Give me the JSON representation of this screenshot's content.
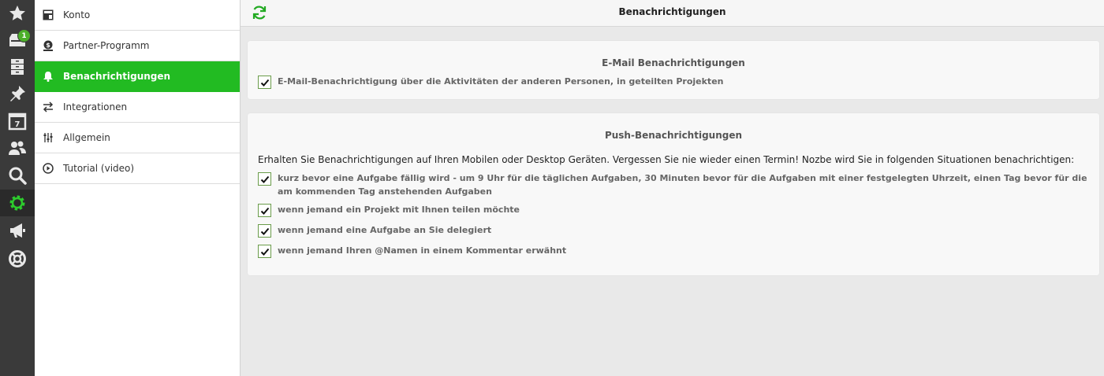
{
  "rail": {
    "items": [
      {
        "name": "favorites-icon"
      },
      {
        "name": "inbox-icon",
        "badge": "1"
      },
      {
        "name": "projects-icon"
      },
      {
        "name": "priority-pin-icon"
      },
      {
        "name": "calendar-icon",
        "day": "7"
      },
      {
        "name": "contacts-icon"
      },
      {
        "name": "search-icon"
      },
      {
        "name": "settings-gear-icon"
      },
      {
        "name": "news-megaphone-icon"
      },
      {
        "name": "help-lifebuoy-icon"
      }
    ]
  },
  "menu": {
    "items": [
      {
        "label": "Konto",
        "icon": "account-icon"
      },
      {
        "label": "Partner-Programm",
        "icon": "partner-icon"
      },
      {
        "label": "Benachrichtigungen",
        "icon": "bell-icon",
        "active": true
      },
      {
        "label": "Integrationen",
        "icon": "swap-arrows-icon"
      },
      {
        "label": "Allgemein",
        "icon": "sliders-icon"
      },
      {
        "label": "Tutorial (video)",
        "icon": "play-icon"
      }
    ]
  },
  "header": {
    "title": "Benachrichtigungen"
  },
  "email": {
    "title": "E-Mail Benachrichtigungen",
    "option": "E-Mail-Benachrichtigung über die Aktivitäten der anderen Personen, in geteilten Projekten",
    "checked": true
  },
  "push": {
    "title": "Push-Benachrichtigungen",
    "intro": "Erhalten Sie Benachrichtigungen auf Ihren Mobilen oder Desktop Geräten. Vergessen Sie nie wieder einen Termin! Nozbe wird Sie in folgenden Situationen benachrichtigen:",
    "options": [
      {
        "text": "kurz bevor eine Aufgabe fällig wird - um 9 Uhr für die täglichen Aufgaben, 30 Minuten bevor für die Aufgaben mit einer festgelegten Uhrzeit, einen Tag bevor für die am kommenden Tag anstehenden Aufgaben",
        "checked": true
      },
      {
        "text": "wenn jemand ein Projekt mit Ihnen teilen möchte",
        "checked": true
      },
      {
        "text": "wenn jemand eine Aufgabe an Sie delegiert",
        "checked": true
      },
      {
        "text": "wenn jemand Ihren @Namen in einem Kommentar erwähnt",
        "checked": true
      }
    ]
  },
  "colors": {
    "accent": "#22bb22",
    "rail": "#3a3a3a",
    "badge": "#4caf2a"
  }
}
